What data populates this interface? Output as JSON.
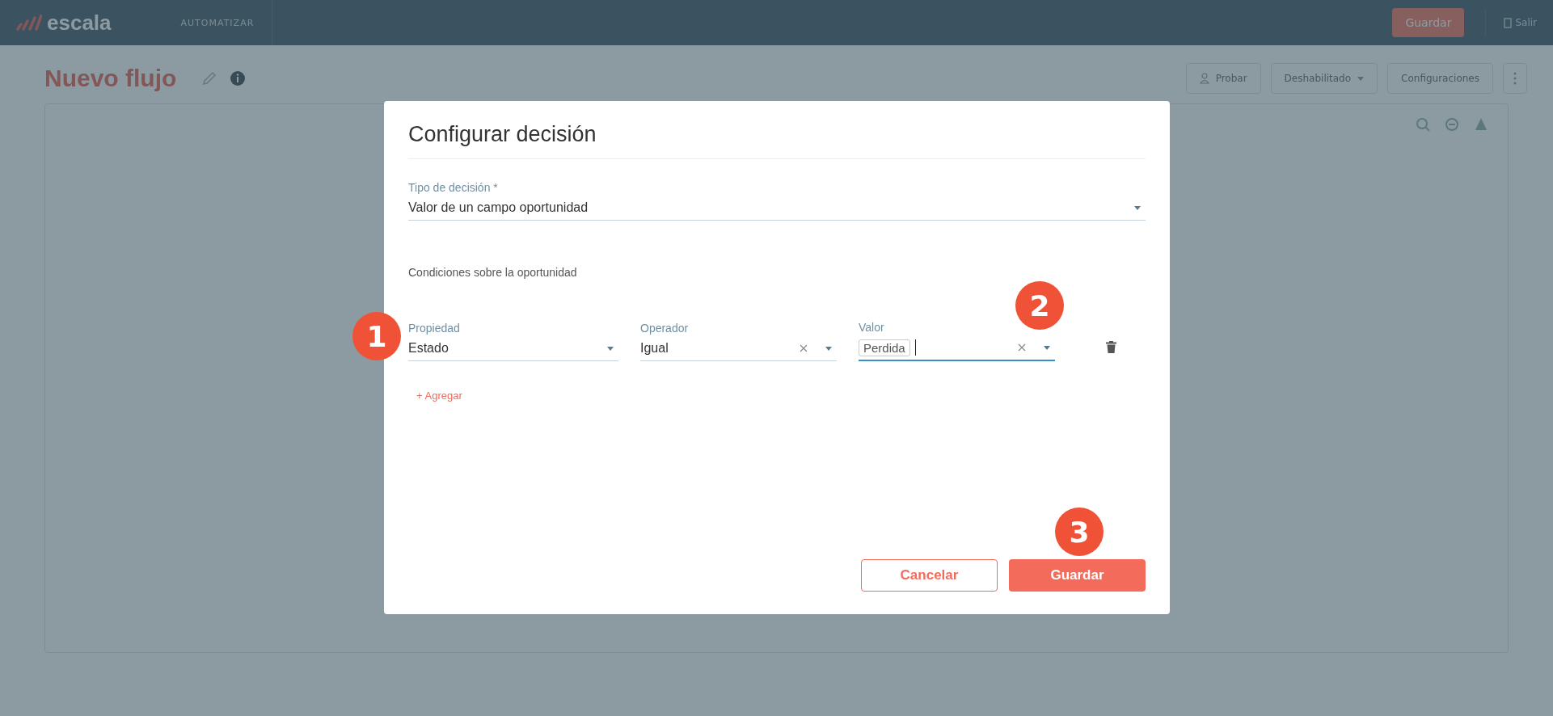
{
  "header": {
    "logo": "escala",
    "section": "AUTOMATIZAR",
    "save_button": "Guardar",
    "exit_button": "Salir"
  },
  "page": {
    "title": "Nuevo flujo",
    "actions": [
      {
        "label": "Probar",
        "kind": "person"
      },
      {
        "label": "Deshabilitado",
        "kind": "dropdown"
      },
      {
        "label": "Configuraciones",
        "kind": "plain"
      }
    ]
  },
  "dialog": {
    "title": "Configurar decisión",
    "decision_type": {
      "label": "Tipo de decisión *",
      "value": "Valor de un campo oportunidad"
    },
    "conditions_heading": "Condiciones sobre la oportunidad",
    "conditions": [
      {
        "label": "Propiedad",
        "kind": "select",
        "value": "Estado",
        "clearable": false,
        "focused": false
      },
      {
        "label": "Operador",
        "kind": "select",
        "value": "Igual",
        "clearable": true,
        "focused": false
      },
      {
        "label": "Valor",
        "kind": "chips",
        "chips": [
          "Perdida"
        ],
        "clearable": true,
        "focused": true
      }
    ],
    "add_link": "+ Agregar",
    "cancel_button": "Cancelar",
    "save_button": "Guardar"
  },
  "callouts": [
    "1",
    "2",
    "3"
  ]
}
